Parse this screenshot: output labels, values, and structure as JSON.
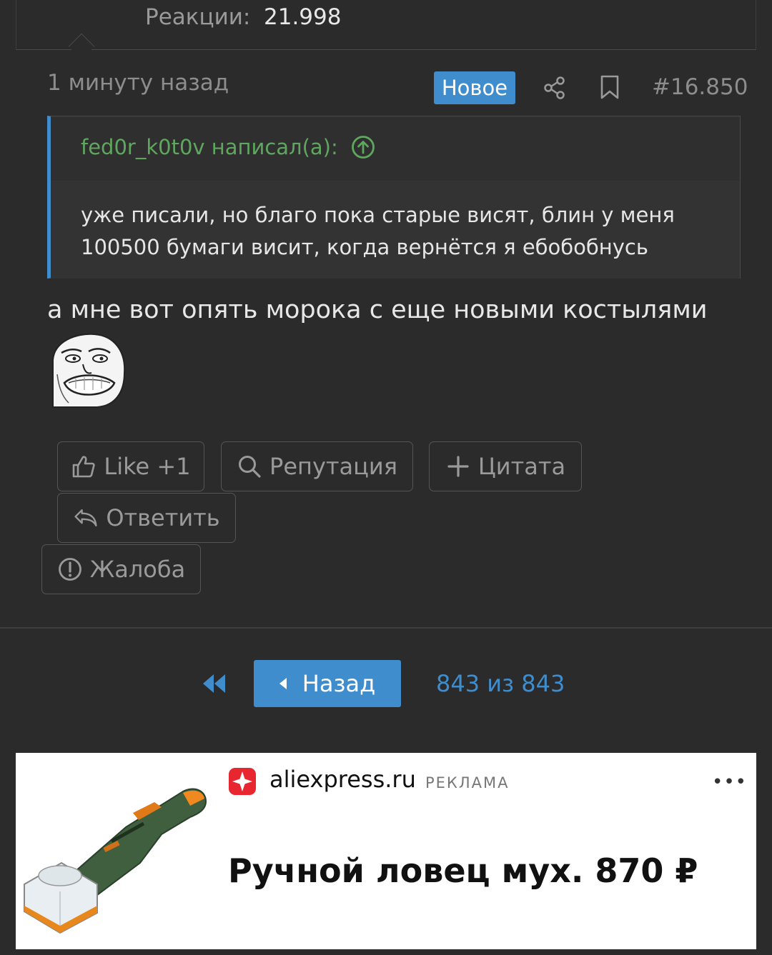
{
  "header_stats": {
    "label": "Реакции:",
    "value": "21.998"
  },
  "post": {
    "time": "1 минуту назад",
    "badge": "Новое",
    "number": "#16.850",
    "quote": {
      "author": "fed0r_k0t0v написал(а):",
      "text": "уже писали, но благо пока старые висят, блин у меня 100500 бумаги висит, когда вернётся я ебобобнусь"
    },
    "message": "а мне вот опять морока с еще новыми костылями",
    "actions": {
      "like": "Like +1",
      "reputation": "Репутация",
      "quote": "Цитата",
      "reply": "Ответить",
      "report": "Жалоба"
    }
  },
  "pagination": {
    "back": "Назад",
    "count": "843 из 843"
  },
  "ad": {
    "domain": "aliexpress.ru",
    "label": "РЕКЛАМА",
    "menu": "•••",
    "title": "Ручной ловец мух. 870 ₽"
  },
  "colors": {
    "accent": "#3f8dcc",
    "author_green": "#5fa75f",
    "background": "#2b2b2b"
  }
}
